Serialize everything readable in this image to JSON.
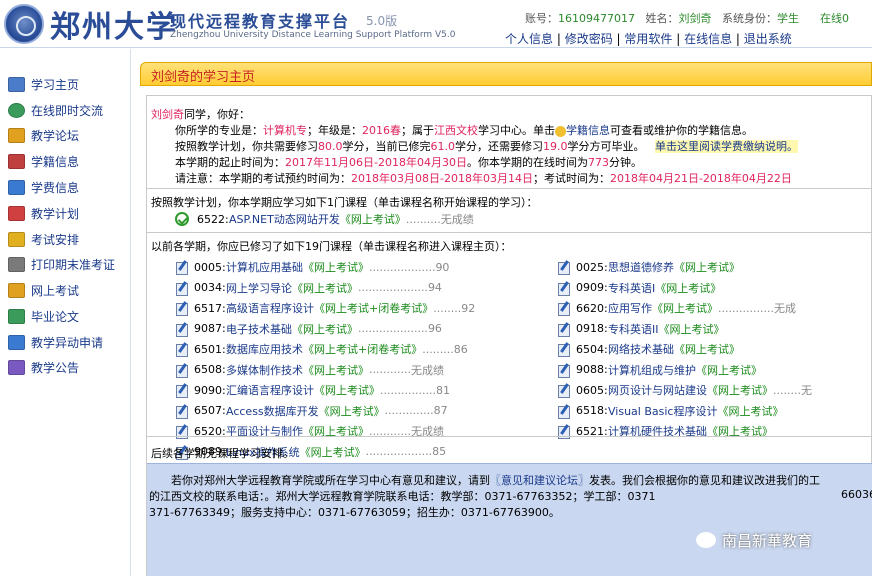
{
  "header": {
    "uni_name": "郑州大学",
    "platform_title": "现代远程教育支撑平台",
    "version": "5.0版",
    "platform_en": "Zhengzhou University Distance Learning Support Platform V5.0",
    "account_label": "账号：",
    "account": "16109477017",
    "name_label": "姓名：",
    "name": "刘剑奇",
    "role_label": "系统身份：",
    "role": "学生",
    "online": "在线0",
    "links": [
      "个人信息",
      "修改密码",
      "常用软件",
      "在线信息",
      "退出系统"
    ]
  },
  "sidebar": {
    "items": [
      {
        "label": "学习主页",
        "icon": "document-icon",
        "color": "#4a7cc9"
      },
      {
        "label": "在线即时交流",
        "icon": "globe-icon",
        "color": "#3a9b5a"
      },
      {
        "label": "教学论坛",
        "icon": "forum-icon",
        "color": "#e0a020"
      },
      {
        "label": "学籍信息",
        "icon": "register-icon",
        "color": "#c04040"
      },
      {
        "label": "学费信息",
        "icon": "chart-icon",
        "color": "#3a7ad0"
      },
      {
        "label": "教学计划",
        "icon": "calendar-icon",
        "color": "#d04040"
      },
      {
        "label": "考试安排",
        "icon": "exam-icon",
        "color": "#e0b020"
      },
      {
        "label": "打印期末准考证",
        "icon": "printer-icon",
        "color": "#7a7a7a"
      },
      {
        "label": "网上考试",
        "icon": "online-exam-icon",
        "color": "#e0a020"
      },
      {
        "label": "毕业论文",
        "icon": "thesis-icon",
        "color": "#3a9b5a"
      },
      {
        "label": "教学异动申请",
        "icon": "apply-icon",
        "color": "#3a7ad0"
      },
      {
        "label": "教学公告",
        "icon": "people-icon",
        "color": "#7a5ac0"
      }
    ]
  },
  "main": {
    "title": "刘剑奇的学习主页",
    "greet_name": "刘剑奇",
    "greet_tail": "同学，你好：",
    "info1": {
      "a": "你所学的专业是：",
      "major": "计算机专",
      "b": "；年级是：",
      "grade": "2016春",
      "c": "；属于",
      "center": "江西文校",
      "d": "学习中心。单击",
      "link": "学籍信息",
      "e": "可查看或维护你的学籍信息。"
    },
    "info2": {
      "a": "按照教学计划，你共需要修习",
      "need": "80.0",
      "b": "学分，当前已修完",
      "done": "61.0",
      "c": "学分，还需要修习",
      "left": "19.0",
      "d": "学分方可毕业。",
      "link": "单击这里阅读学费缴纳说明。"
    },
    "info3": {
      "a": "本学期的起止时间为：",
      "period": "2017年11月06日-2018年04月30日",
      "b": "。你本学期的在线时间为",
      "mins": "773",
      "c": "分钟。"
    },
    "info4": {
      "a": "请注意：本学期的考试预约时间为：",
      "booking": "2018年03月08日-2018年03月14日",
      "b": "；考试时间为：",
      "exam": "2018年04月21日-2018年04月22日"
    },
    "current_head": "按照教学计划，你本学期应学习如下1门课程（单击课程名称开始课程的学习）：",
    "current": {
      "code": "6522:",
      "name": "ASP.NET动态网站开发",
      "exam": "《网上考试》",
      "dots": "..........",
      "score": "无成绩"
    },
    "prev_head": "以前各学期，你应已修习了如下19门课程（单击课程名称进入课程主页）：",
    "left_courses": [
      {
        "code": "0005:",
        "name": "计算机应用基础",
        "exam": "《网上考试》",
        "dots": "...................",
        "score": "90"
      },
      {
        "code": "0034:",
        "name": "网上学习导论",
        "exam": "《网上考试》",
        "dots": "....................",
        "score": "94"
      },
      {
        "code": "6517:",
        "name": "高级语言程序设计",
        "exam": "《网上考试+闭卷考试》",
        "dots": "........",
        "score": "92"
      },
      {
        "code": "9087:",
        "name": "电子技术基础",
        "exam": "《网上考试》",
        "dots": "....................",
        "score": "96"
      },
      {
        "code": "6501:",
        "name": "数据库应用技术",
        "exam": "《网上考试+闭卷考试》",
        "dots": ".........",
        "score": "86"
      },
      {
        "code": "6508:",
        "name": "多媒体制作技术",
        "exam": "《网上考试》",
        "dots": "............",
        "score": "无成绩"
      },
      {
        "code": "9090:",
        "name": "汇编语言程序设计",
        "exam": "《网上考试》",
        "dots": "................",
        "score": "81"
      },
      {
        "code": "6507:",
        "name": "Access数据库开发",
        "exam": "《网上考试》",
        "dots": "..............",
        "score": "87"
      },
      {
        "code": "6520:",
        "name": "平面设计与制作",
        "exam": "《网上考试》",
        "dots": "............",
        "score": "无成绩"
      },
      {
        "code": "9089:",
        "name": "Linux操作系统",
        "exam": "《网上考试》",
        "dots": "...................",
        "score": "85"
      }
    ],
    "right_courses": [
      {
        "code": "0025:",
        "name": "思想道德修养",
        "exam": "《网上考试》",
        "dots": "",
        "score": ""
      },
      {
        "code": "0909:",
        "name": "专科英语I",
        "exam": "《网上考试》",
        "dots": "",
        "score": ""
      },
      {
        "code": "6620:",
        "name": "应用写作",
        "exam": "《网上考试》",
        "dots": "................",
        "score": "无成"
      },
      {
        "code": "0918:",
        "name": "专科英语II",
        "exam": "《网上考试》",
        "dots": "",
        "score": ""
      },
      {
        "code": "6504:",
        "name": "网络技术基础",
        "exam": "《网上考试》",
        "dots": "",
        "score": ""
      },
      {
        "code": "9088:",
        "name": "计算机组成与维护",
        "exam": "《网上考试》",
        "dots": "",
        "score": ""
      },
      {
        "code": "0605:",
        "name": "网页设计与网站建设",
        "exam": "《网上考试》",
        "dots": "........",
        "score": "无"
      },
      {
        "code": "6518:",
        "name": "Visual Basic程序设计",
        "exam": "《网上考试》",
        "dots": "",
        "score": ""
      },
      {
        "code": "6521:",
        "name": "计算机硬件技术基础",
        "exam": "《网上考试》",
        "dots": "",
        "score": ""
      }
    ],
    "next_head": "后续各学期无课程学习安排。",
    "footer1": {
      "a": "若你对郑州大学远程教育学院或所在学习中心有意见和建议，请到",
      "link": "〖意见和建议论坛〗",
      "b": "发表。我们会根据你的意见和建议改进我们的工"
    },
    "footer2": "的江西文校的联系电话：。郑州大学远程教育学院联系电话：教学部：0371-67763352；学工部：0371",
    "footer2r": "66036",
    "footer3": "371-67763349；服务支持中心：0371-67763059；招生办：0371-67763900。"
  },
  "watermark": "南昌新華教育",
  "colors": {
    "accent": "#1a3a8a",
    "highlight": "#e0245e",
    "exam_green": "#1a8a1a",
    "tab": "#ffcc33"
  }
}
